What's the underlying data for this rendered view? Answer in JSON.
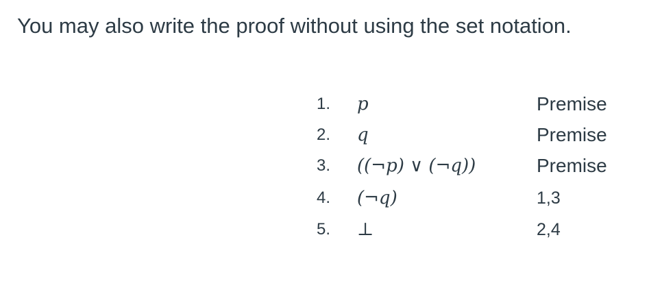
{
  "heading": "You may also write the proof without using the set notation.",
  "proof": {
    "lines": [
      {
        "number": "1.",
        "formula": "p",
        "justification": "Premise"
      },
      {
        "number": "2.",
        "formula": "q",
        "justification": "Premise"
      },
      {
        "number": "3.",
        "formula": "((¬p) ∨ (¬q))",
        "justification": "Premise"
      },
      {
        "number": "4.",
        "formula": "(¬q)",
        "justification": "1,3"
      },
      {
        "number": "5.",
        "formula": "⊥",
        "justification": "2,4"
      }
    ]
  }
}
